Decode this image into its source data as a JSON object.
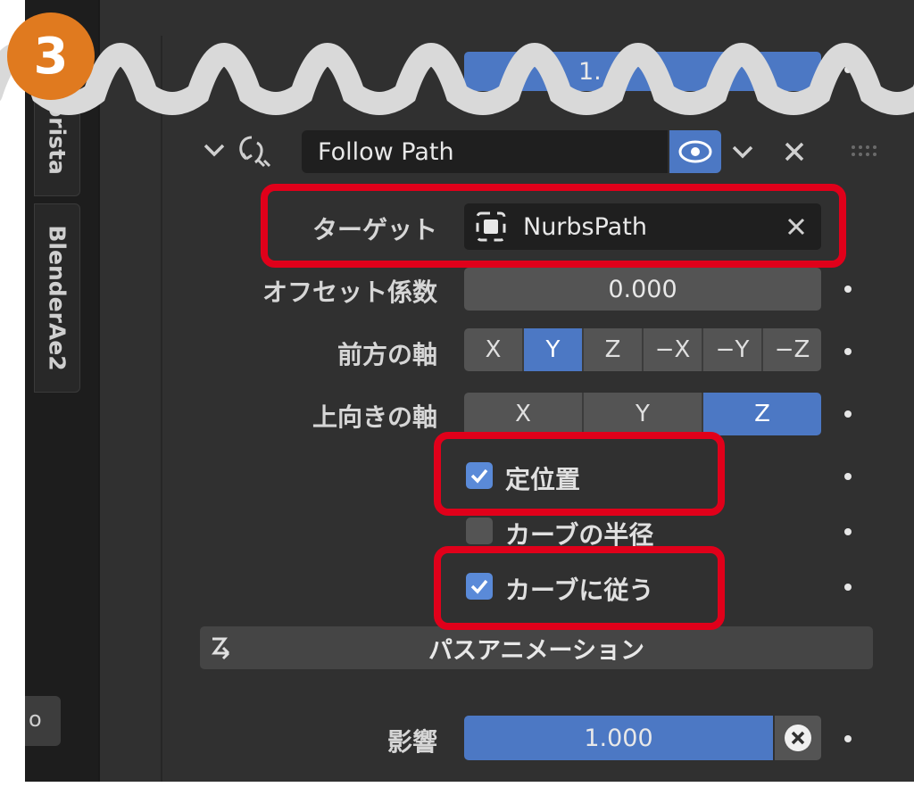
{
  "step_badge": {
    "number": "3",
    "color": "#e07a1f"
  },
  "sidebar": {
    "tabs": [
      {
        "label": "orista"
      },
      {
        "label": "BlenderAe2"
      }
    ],
    "bottom_tab": {
      "label": "o"
    }
  },
  "top_field": {
    "value": "1."
  },
  "constraint": {
    "name": "Follow Path",
    "icons": {
      "expand": "chevron-down-icon",
      "type": "follow-path-icon",
      "visibility": "eye-icon",
      "menu": "chevron-down-icon",
      "delete": "close-icon",
      "drag": "drag-handle-icon"
    }
  },
  "target": {
    "label": "ターゲット",
    "value": "NurbsPath"
  },
  "offset": {
    "label": "オフセット係数",
    "value": "0.000"
  },
  "forward_axis": {
    "label": "前方の軸",
    "options": [
      "X",
      "Y",
      "Z",
      "−X",
      "−Y",
      "−Z"
    ],
    "selected": "Y"
  },
  "up_axis": {
    "label": "上向きの軸",
    "options": [
      "X",
      "Y",
      "Z"
    ],
    "selected": "Z"
  },
  "checkboxes": {
    "fixed_position": {
      "label": "定位置",
      "checked": true
    },
    "curve_radius": {
      "label": "カーブの半径",
      "checked": false
    },
    "follow_curve": {
      "label": "カーブに従う",
      "checked": true
    }
  },
  "animate_path": {
    "label": "パスアニメーション"
  },
  "influence": {
    "label": "影響",
    "value": "1.000"
  },
  "colors": {
    "panel": "#303030",
    "field": "#545454",
    "accent": "#4c78c4",
    "highlight": "#e0001a",
    "wave": "#d9d9d9"
  }
}
